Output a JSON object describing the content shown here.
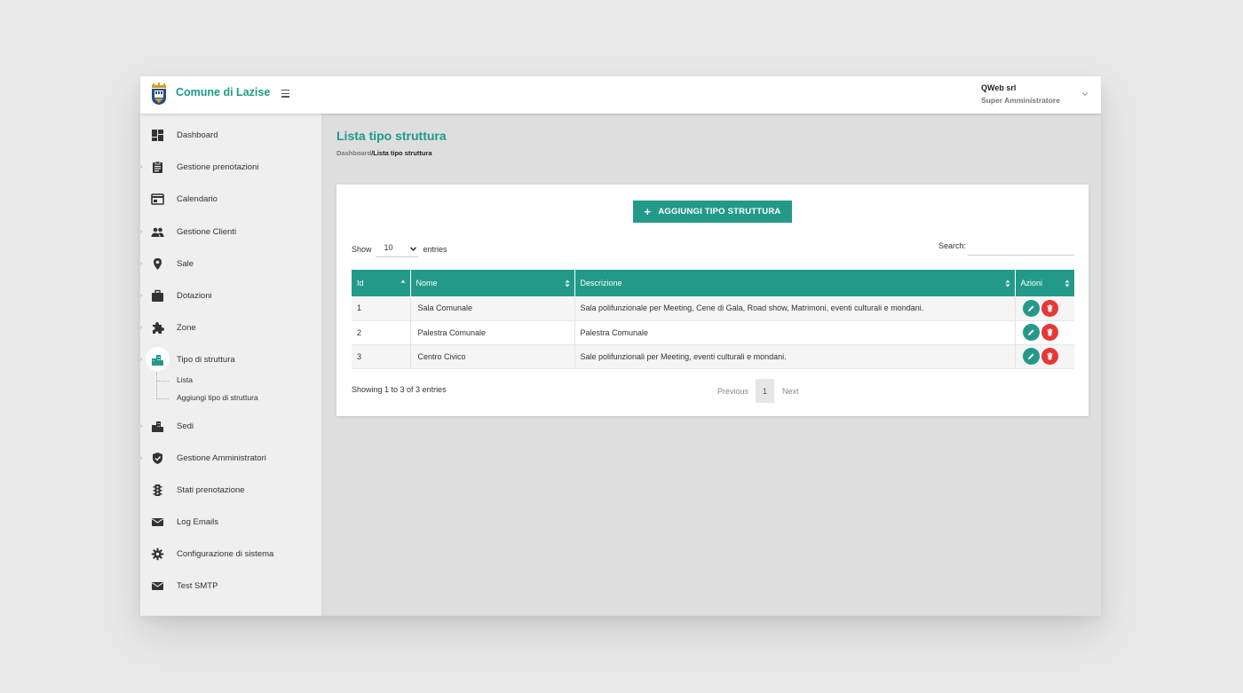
{
  "colors": {
    "accent": "#23998a",
    "title": "#1e9a8a",
    "danger": "#e53935"
  },
  "header": {
    "app_title": "Comune di Lazise",
    "user_name": "QWeb srl",
    "user_role": "Super Amministratore"
  },
  "sidebar": {
    "items": [
      {
        "label": "Dashboard",
        "icon": "dashboard-icon"
      },
      {
        "label": "Gestione prenotazioni",
        "icon": "clipboard-icon"
      },
      {
        "label": "Calendario",
        "icon": "calendar-icon"
      },
      {
        "label": "Gestione Clienti",
        "icon": "people-icon"
      },
      {
        "label": "Sale",
        "icon": "location-pin-icon"
      },
      {
        "label": "Dotazioni",
        "icon": "briefcase-icon"
      },
      {
        "label": "Zone",
        "icon": "puzzle-icon"
      },
      {
        "label": "Tipo di struttura",
        "icon": "buildings-icon"
      },
      {
        "label": "Sedi",
        "icon": "buildings-icon"
      },
      {
        "label": "Gestione Amministratori",
        "icon": "shield-check-icon"
      },
      {
        "label": "Stati prenotazione",
        "icon": "traffic-light-icon"
      },
      {
        "label": "Log Emails",
        "icon": "mail-icon"
      },
      {
        "label": "Configurazione di sistema",
        "icon": "gear-icon"
      },
      {
        "label": "Test SMTP",
        "icon": "mail-icon"
      }
    ],
    "subitems": [
      {
        "label": "Lista"
      },
      {
        "label": "Aggiungi tipo di struttura"
      }
    ]
  },
  "page": {
    "title": "Lista tipo struttura",
    "breadcrumb_root": "Dashboard",
    "breadcrumb_current": "/Lista tipo struttura",
    "add_button": "AGGIUNGI TIPO STRUTTURA"
  },
  "table_controls": {
    "show_label": "Show",
    "entries_value": "10",
    "entries_label": "entries",
    "search_label": "Search:",
    "search_value": ""
  },
  "table": {
    "headers": [
      "Id",
      "Nome",
      "Descrizione",
      "Azioni"
    ],
    "rows": [
      {
        "id": "1",
        "nome": "Sala Comunale",
        "descrizione": "Sala polifunzionale per Meeting, Cene di Gala, Road show, Matrimoni, eventi culturali e mondani."
      },
      {
        "id": "2",
        "nome": "Palestra Comunale",
        "descrizione": "Palestra Comunale"
      },
      {
        "id": "3",
        "nome": "Centro Civico",
        "descrizione": "Sale polifunzionali per Meeting, eventi culturali e mondani."
      }
    ]
  },
  "footer": {
    "info": "Showing 1 to 3 of 3 entries",
    "previous": "Previous",
    "current_page": "1",
    "next": "Next"
  }
}
